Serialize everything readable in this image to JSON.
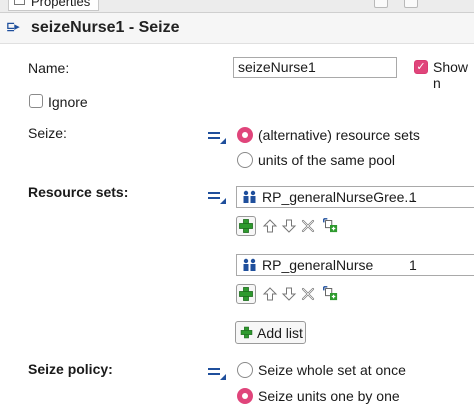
{
  "tab": {
    "label": "Properties"
  },
  "header": {
    "title": "seizeNurse1 - Seize"
  },
  "name_field": {
    "label": "Name:",
    "value": "seizeNurse1"
  },
  "show_name": {
    "label": "Show n",
    "checked": true
  },
  "ignore": {
    "label": "Ignore",
    "checked": false
  },
  "seize": {
    "label": "Seize:",
    "options": [
      "(alternative) resource sets",
      "units of the same pool"
    ],
    "selected": 0
  },
  "resource_sets": {
    "label": "Resource sets:",
    "sets": [
      {
        "name": "RP_generalNurseGree...",
        "qty": "1"
      },
      {
        "name": "RP_generalNurse",
        "qty": "1"
      }
    ],
    "add_list_label": "Add list"
  },
  "seize_policy": {
    "label": "Seize policy:",
    "options": [
      "Seize whole set at once",
      "Seize units one by one"
    ],
    "selected": 1
  },
  "icons": {
    "header": "object-tree-icon",
    "equals": "static-value-toggle-icon",
    "resource": "resource-pool-icon",
    "add": "green-plus-icon",
    "up": "arrow-up-icon",
    "down": "arrow-down-icon",
    "delete": "delete-x-icon",
    "select": "select-resource-icon"
  },
  "colors": {
    "accent": "#e0457b",
    "green": "#2e9a2e",
    "icon_blue": "#1f4f9c"
  }
}
